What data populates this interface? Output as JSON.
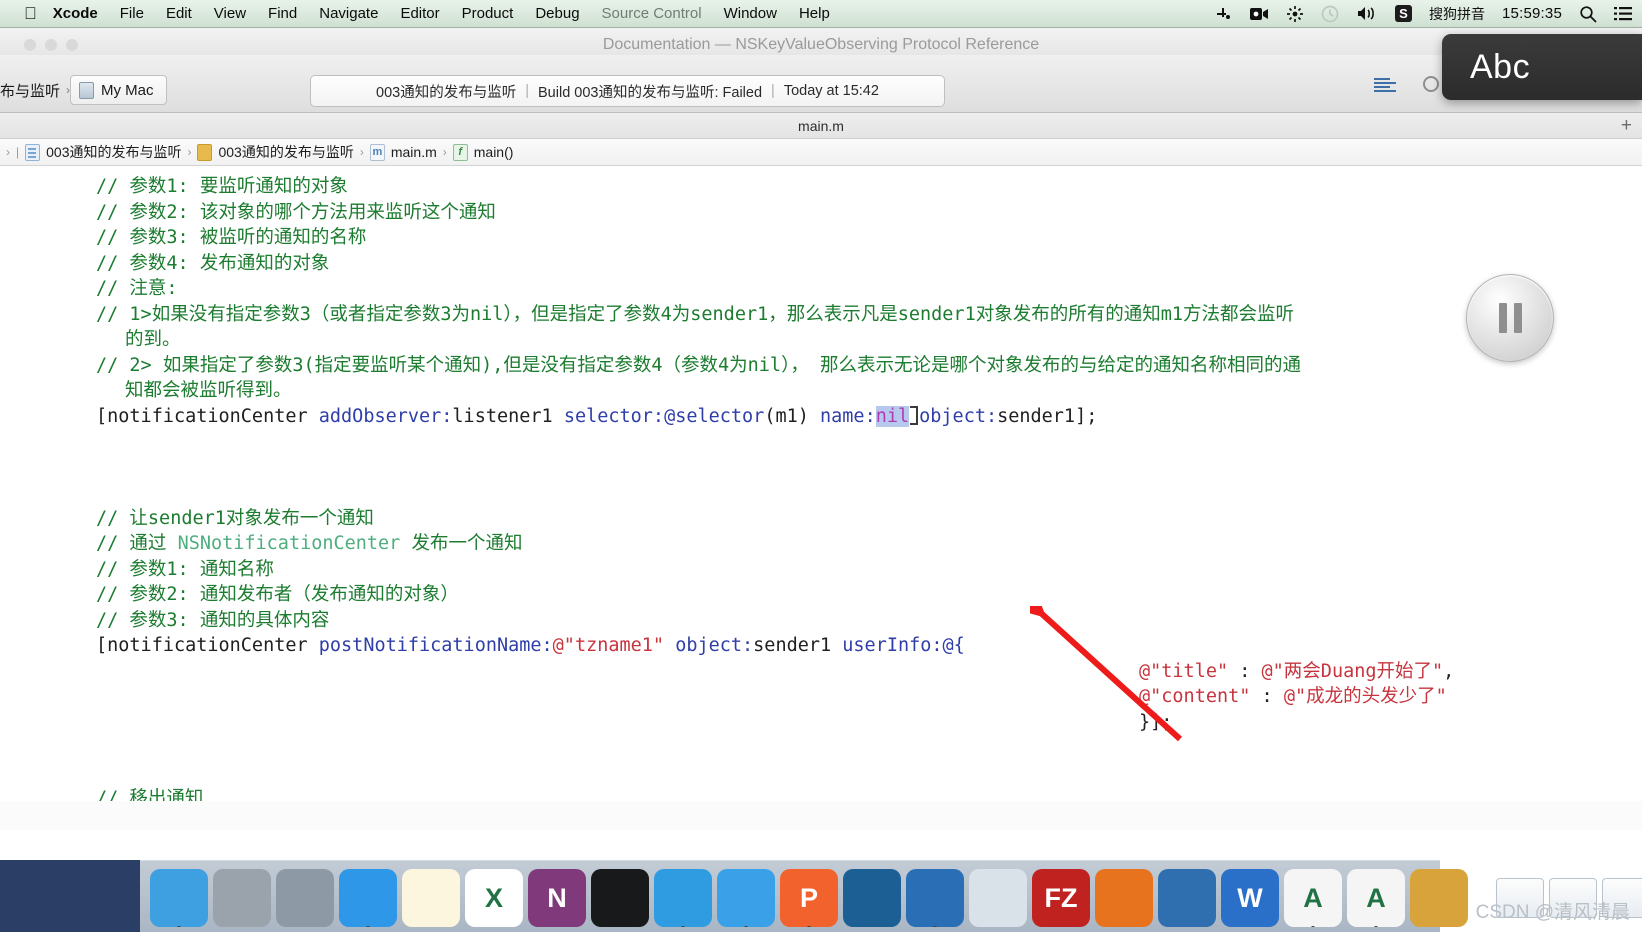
{
  "menubar": {
    "apple_icon": "apple-logo-icon",
    "items": [
      {
        "label": "Xcode",
        "bold": true
      },
      {
        "label": "File",
        "bold": false
      },
      {
        "label": "Edit",
        "bold": false
      },
      {
        "label": "View",
        "bold": false
      },
      {
        "label": "Find",
        "bold": false
      },
      {
        "label": "Navigate",
        "bold": false
      },
      {
        "label": "Editor",
        "bold": false
      },
      {
        "label": "Product",
        "bold": false
      },
      {
        "label": "Debug",
        "bold": false
      },
      {
        "label": "Source Control",
        "bold": false
      },
      {
        "label": "Window",
        "bold": false
      },
      {
        "label": "Help",
        "bold": false
      }
    ],
    "status": {
      "icons": [
        "shortcut-icon",
        "screen-record-icon",
        "airdrop-icon",
        "time-machine-icon",
        "volume-icon"
      ],
      "ime_badge": "S",
      "ime_label": "搜狗拼音",
      "clock": "15:59:35",
      "search_icon": "search-icon",
      "notification_center_icon": "list-icon"
    }
  },
  "background_window": {
    "title": "Documentation — NSKeyValueObserving Protocol Reference"
  },
  "ime_overlay": {
    "label": "Abc"
  },
  "xcode": {
    "toolbar": {
      "scheme_prefix": "布与监听",
      "destination": "My Mac",
      "destination_icon": "mac-display-icon",
      "activity": {
        "scheme": "003通知的发布与监听",
        "status": "Build 003通知的发布与监听: Failed",
        "time": "Today at 15:42",
        "separator": "|"
      }
    },
    "tabbar": {
      "tab_label": "main.m",
      "add_tab": "+"
    },
    "jumpbar": {
      "crumbs": [
        {
          "label": "003通知的发布与监听",
          "icon": "project-icon"
        },
        {
          "label": "003通知的发布与监听",
          "icon": "folder-icon"
        },
        {
          "label": "main.m",
          "icon": "objc-file-icon"
        },
        {
          "label": "main()",
          "icon": "function-icon"
        }
      ],
      "separator": "›"
    },
    "hud": {
      "name": "pause-button"
    }
  },
  "code": {
    "lines": [
      {
        "id": "l1",
        "indent": 0,
        "segments": [
          {
            "t": "// 参数1: 要监听通知的对象",
            "c": "com"
          }
        ]
      },
      {
        "id": "l2",
        "indent": 0,
        "segments": [
          {
            "t": "// 参数2: 该对象的哪个方法用来监听这个通知",
            "c": "com"
          }
        ]
      },
      {
        "id": "l3",
        "indent": 0,
        "segments": [
          {
            "t": "// 参数3: 被监听的通知的名称",
            "c": "com"
          }
        ]
      },
      {
        "id": "l4",
        "indent": 0,
        "segments": [
          {
            "t": "// 参数4: 发布通知的对象",
            "c": "com"
          }
        ]
      },
      {
        "id": "l5",
        "indent": 0,
        "segments": [
          {
            "t": "// 注意:",
            "c": "com"
          }
        ]
      },
      {
        "id": "l6",
        "indent": 0,
        "segments": [
          {
            "t": "// 1>如果没有指定参数3（或者指定参数3为nil），但是指定了参数4为sender1，那么表示凡是sender1对象发布的所有的通知m1方法都会监听",
            "c": "com"
          }
        ]
      },
      {
        "id": "l7",
        "indent": 1,
        "segments": [
          {
            "t": "的到。",
            "c": "com"
          }
        ]
      },
      {
        "id": "l8",
        "indent": 0,
        "segments": [
          {
            "t": "// 2> 如果指定了参数3(指定要监听某个通知),但是没有指定参数4（参数4为nil）， 那么表示无论是哪个对象发布的与给定的通知名称相同的通",
            "c": "com"
          }
        ]
      },
      {
        "id": "l9",
        "indent": 1,
        "segments": [
          {
            "t": "知都会被监听得到。",
            "c": "com"
          }
        ]
      },
      {
        "id": "l10",
        "indent": 0,
        "segments": [
          {
            "t": "[notificationCenter ",
            "c": "plain"
          },
          {
            "t": "addObserver:",
            "c": "msg"
          },
          {
            "t": "listener1 ",
            "c": "plain"
          },
          {
            "t": "selector:",
            "c": "msg"
          },
          {
            "t": "@selector",
            "c": "msg"
          },
          {
            "t": "(m1) ",
            "c": "plain"
          },
          {
            "t": "name:",
            "c": "msg"
          },
          {
            "t": "nil",
            "c": "sel"
          },
          {
            "t": "__CARET__",
            "c": "caret"
          },
          {
            "t": "object:",
            "c": "msg"
          },
          {
            "t": "sender1];",
            "c": "plain"
          }
        ]
      },
      {
        "id": "l11",
        "indent": 0,
        "segments": [
          {
            "t": " ",
            "c": "plain"
          }
        ]
      },
      {
        "id": "l12",
        "indent": 0,
        "segments": [
          {
            "t": " ",
            "c": "plain"
          }
        ]
      },
      {
        "id": "l13",
        "indent": 0,
        "segments": [
          {
            "t": " ",
            "c": "plain"
          }
        ]
      },
      {
        "id": "l14",
        "indent": 0,
        "segments": [
          {
            "t": "// 让sender1对象发布一个通知",
            "c": "com"
          }
        ]
      },
      {
        "id": "l15",
        "indent": 0,
        "segments": [
          {
            "t": "// 通过 ",
            "c": "com"
          },
          {
            "t": "NSNotificationCenter",
            "c": "comtype"
          },
          {
            "t": " 发布一个通知",
            "c": "com"
          }
        ]
      },
      {
        "id": "l16",
        "indent": 0,
        "segments": [
          {
            "t": "// 参数1: 通知名称",
            "c": "com"
          }
        ]
      },
      {
        "id": "l17",
        "indent": 0,
        "segments": [
          {
            "t": "// 参数2: 通知发布者（发布通知的对象）",
            "c": "com"
          }
        ]
      },
      {
        "id": "l18",
        "indent": 0,
        "segments": [
          {
            "t": "// 参数3: 通知的具体内容",
            "c": "com"
          }
        ]
      },
      {
        "id": "l19",
        "indent": 0,
        "segments": [
          {
            "t": "[notificationCenter ",
            "c": "plain"
          },
          {
            "t": "postNotificationName:",
            "c": "msg"
          },
          {
            "t": "@\"tzname1\"",
            "c": "str"
          },
          {
            "t": " ",
            "c": "plain"
          },
          {
            "t": "object:",
            "c": "msg"
          },
          {
            "t": "sender1 ",
            "c": "plain"
          },
          {
            "t": "userInfo:",
            "c": "msg"
          },
          {
            "t": "@{",
            "c": "at"
          }
        ]
      },
      {
        "id": "l20",
        "indent": 2,
        "segments": [
          {
            "t": "@\"title\"",
            "c": "str"
          },
          {
            "t": " : ",
            "c": "plain"
          },
          {
            "t": "@\"两会Duang开始了\"",
            "c": "str"
          },
          {
            "t": ",",
            "c": "plain"
          }
        ]
      },
      {
        "id": "l21",
        "indent": 2,
        "segments": [
          {
            "t": "@\"content\"",
            "c": "str"
          },
          {
            "t": " : ",
            "c": "plain"
          },
          {
            "t": "@\"成龙的头发少了\"",
            "c": "str"
          }
        ]
      },
      {
        "id": "l22",
        "indent": 2,
        "segments": [
          {
            "t": "}];",
            "c": "plain"
          }
        ]
      },
      {
        "id": "l23",
        "indent": 0,
        "segments": [
          {
            "t": " ",
            "c": "plain"
          }
        ]
      },
      {
        "id": "l24",
        "indent": 0,
        "segments": [
          {
            "t": " ",
            "c": "plain"
          }
        ]
      },
      {
        "id": "l25",
        "indent": 0,
        "segments": [
          {
            "t": "// 移出通知",
            "c": "com"
          }
        ]
      }
    ],
    "colors": {
      "comment": "#1c7c2f",
      "comment_type": "#4fae7f",
      "plain": "#202020",
      "message": "#2f3ea8",
      "string": "#c7343e",
      "keyword": "#b13bb1",
      "selection": "#b7c8ef"
    }
  },
  "annotation": {
    "arrow_color": "#ee1b1b",
    "name": "red-arrow-pointing-at-nil"
  },
  "dock": {
    "apps": [
      {
        "name": "finder-icon",
        "glyph": "",
        "bg": "#3ea0e0",
        "running": true
      },
      {
        "name": "system-preferences-icon",
        "glyph": "",
        "bg": "#9aa3ab",
        "running": false
      },
      {
        "name": "launchpad-icon",
        "glyph": "",
        "bg": "#8d9aa6",
        "running": false
      },
      {
        "name": "safari-icon",
        "glyph": "",
        "bg": "#2f97e8",
        "running": true
      },
      {
        "name": "notes-icon",
        "glyph": "",
        "bg": "#fdf6de",
        "running": false
      },
      {
        "name": "excel-icon",
        "glyph": "X",
        "bg": "#ffffff",
        "running": false
      },
      {
        "name": "onenote-icon",
        "glyph": "N",
        "bg": "#80397b",
        "running": false
      },
      {
        "name": "terminal-icon",
        "glyph": "",
        "bg": "#17191a",
        "running": false
      },
      {
        "name": "xcode-icon",
        "glyph": "",
        "bg": "#2f9be0",
        "running": true
      },
      {
        "name": "simulator-icon",
        "glyph": "",
        "bg": "#3aa0e8",
        "running": true
      },
      {
        "name": "pycharm-icon",
        "glyph": "P",
        "bg": "#f2622c",
        "running": true
      },
      {
        "name": "snipaste-icon",
        "glyph": "",
        "bg": "#1b5f94",
        "running": false
      },
      {
        "name": "quicktime-icon",
        "glyph": "",
        "bg": "#2a6fb5",
        "running": true
      },
      {
        "name": "vlc-icon",
        "glyph": "",
        "bg": "#d8e2e8",
        "running": false
      },
      {
        "name": "filezilla-icon",
        "glyph": "FZ",
        "bg": "#c0221f",
        "running": false
      },
      {
        "name": "firefox-icon",
        "glyph": "",
        "bg": "#e8731f",
        "running": false
      },
      {
        "name": "paintbrush-icon",
        "glyph": "",
        "bg": "#2f6fb0",
        "running": false
      },
      {
        "name": "word-icon",
        "glyph": "W",
        "bg": "#2a6fc8",
        "running": false
      },
      {
        "name": "font-book-icon",
        "glyph": "A",
        "bg": "#f5f5f5",
        "running": true
      },
      {
        "name": "preview-icon",
        "glyph": "A",
        "bg": "#f5f5f5",
        "running": true
      },
      {
        "name": "image-capture-icon",
        "glyph": "",
        "bg": "#d8a33a",
        "running": false
      }
    ],
    "minimized": [
      {
        "name": "minimized-window-1"
      },
      {
        "name": "minimized-window-2"
      },
      {
        "name": "minimized-window-3"
      },
      {
        "name": "minimized-window-4"
      },
      {
        "name": "minimized-window-5"
      },
      {
        "name": "minimized-window-6"
      }
    ],
    "trash": {
      "name": "trash-icon"
    }
  },
  "watermark": {
    "text": "CSDN @清风清晨"
  }
}
